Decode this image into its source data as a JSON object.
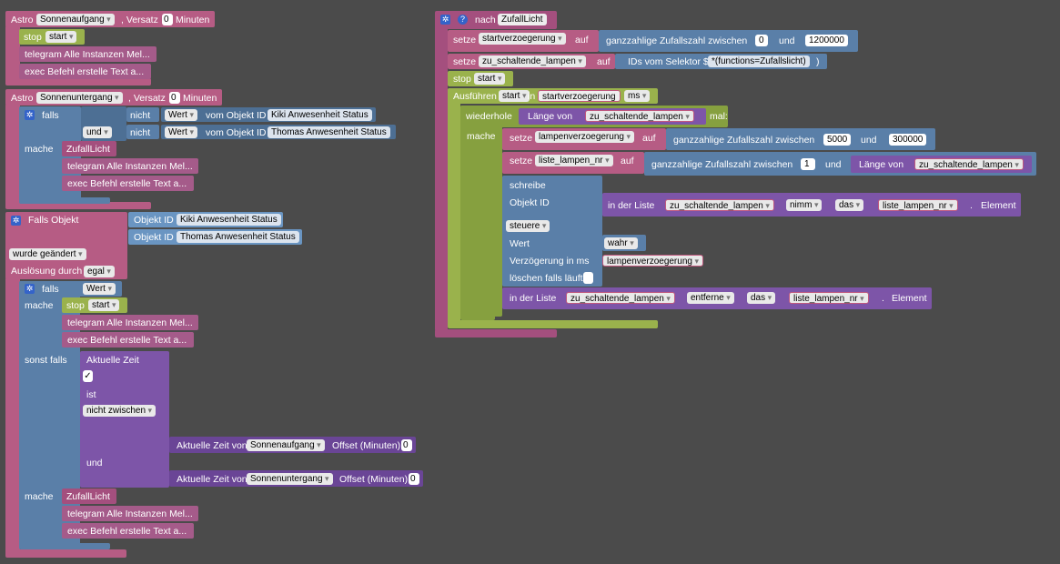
{
  "left": {
    "block1": {
      "astro_label": "Astro",
      "astro_value": "Sonnenaufgang",
      "offset_label": ", Versatz",
      "offset_value": "0",
      "minutes_label": "Minuten",
      "stop_label": "stop",
      "stop_value": "start",
      "telegram_label": "telegram Alle Instanzen Mel...",
      "exec_label": "exec Befehl erstelle Text a..."
    },
    "block2": {
      "astro_label": "Astro",
      "astro_value": "Sonnenuntergang",
      "offset_label": ", Versatz",
      "offset_value": "0",
      "minutes_label": "Minuten",
      "if_label": "falls",
      "not_label": "nicht",
      "value_value": "Wert",
      "obj_label": "vom Objekt ID",
      "obj1": "Kiki Anwesenheit Status",
      "and_value": "und",
      "obj2": "Thomas Anwesenheit Status",
      "do_label": "mache",
      "call_label": "ZufallLicht",
      "telegram_label": "telegram Alle Instanzen Mel...",
      "exec_label": "exec Befehl erstelle Text a..."
    },
    "block3": {
      "trigger_label": "Falls Objekt",
      "objid_label": "Objekt ID",
      "obj1": "Kiki Anwesenheit Status",
      "obj2": "Thomas Anwesenheit Status",
      "changed_value": "wurde geändert",
      "cause_label": "Auslösung durch",
      "cause_value": "egal",
      "if_label": "falls",
      "if_value": "Wert",
      "do_label": "mache",
      "stop_label": "stop",
      "stop_value": "start",
      "telegram_label": "telegram Alle Instanzen Mel...",
      "exec_label": "exec Befehl erstelle Text a...",
      "elseif_label": "sonst falls",
      "current_time_label": "Aktuelle Zeit",
      "check_symbol": "✓",
      "is_label": "ist",
      "between_value": "nicht zwischen",
      "and_label": "und",
      "time_label_1": "Aktuelle Zeit von",
      "time_value_1": "Sonnenaufgang",
      "offset_label_1": "Offset (Minuten)",
      "offset_value_1": "0",
      "time_label_2": "Aktuelle Zeit von",
      "time_value_2": "Sonnenuntergang",
      "offset_label_2": "Offset (Minuten)",
      "offset_value_2": "0",
      "do2_label": "mache",
      "call_label": "ZufallLicht",
      "telegram2_label": "telegram Alle Instanzen Mel...",
      "exec2_label": "exec Befehl erstelle Text a..."
    }
  },
  "right": {
    "func_label": "nach",
    "func_name": "ZufallLicht",
    "set_label": "setze",
    "var1": "startverzoegerung",
    "to_label": "auf",
    "rand_label": "ganzzahlige Zufallszahl zwischen",
    "rand1_min": "0",
    "and_label": "und",
    "rand1_max": "1200000",
    "var2": "zu_schaltende_lampen",
    "selector_label": "IDs vom Selektor $(",
    "selector_value": "*(functions=Zufallslicht)",
    "selector_close": ")",
    "stop_label": "stop",
    "stop_value": "start",
    "exec_label": "Ausführen",
    "exec_value": "start",
    "in_label": "in",
    "exec_var": "startverzoegerung",
    "ms_value": "ms",
    "repeat_label": "wiederhole",
    "length_label": "Länge von",
    "repeat_var": "zu_schaltende_lampen",
    "times_label": "mal:",
    "do_label": "mache",
    "var3": "lampenverzoegerung",
    "rand2_min": "5000",
    "rand2_max": "300000",
    "var4": "liste_lampen_nr",
    "rand3_min": "1",
    "length2_var": "zu_schaltende_lampen",
    "write_label": "schreibe",
    "objid_label": "Objekt ID",
    "inlist_label": "in der Liste",
    "list_var": "zu_schaltende_lampen",
    "take_value": "nimm",
    "the_value": "das",
    "index_var": "liste_lampen_nr",
    "dot_label": ".",
    "element_label": "Element",
    "control_value": "steuere",
    "value_label": "Wert",
    "value_value": "wahr",
    "delay_label": "Verzögerung in ms",
    "delay_var": "lampenverzoegerung",
    "clear_label": "löschen falls läuft",
    "inlist2_label": "in der Liste",
    "list2_var": "zu_schaltende_lampen",
    "remove_value": "entferne",
    "the2_value": "das",
    "index2_var": "liste_lampen_nr",
    "element2_label": "Element"
  }
}
